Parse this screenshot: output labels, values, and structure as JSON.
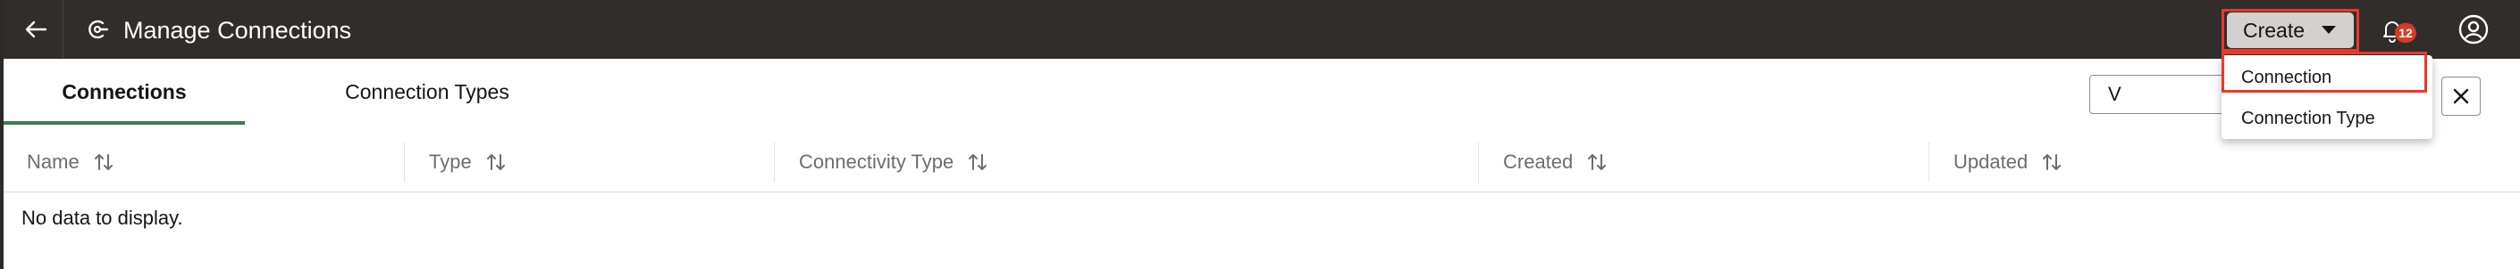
{
  "header": {
    "title": "Manage Connections",
    "create_label": "Create",
    "notification_count": "12"
  },
  "create_menu": {
    "items": [
      "Connection",
      "Connection Type"
    ]
  },
  "tabs": [
    {
      "label": "Connections",
      "active": true
    },
    {
      "label": "Connection Types",
      "active": false
    }
  ],
  "filter": {
    "value": "V"
  },
  "table": {
    "columns": [
      "Name",
      "Type",
      "Connectivity Type",
      "Created",
      "Updated"
    ],
    "empty_message": "No data to display."
  },
  "colors": {
    "header_bg": "#312d2a",
    "highlight": "#e8392d",
    "active_tab_underline": "#3f7d4c",
    "badge": "#d63b25"
  }
}
